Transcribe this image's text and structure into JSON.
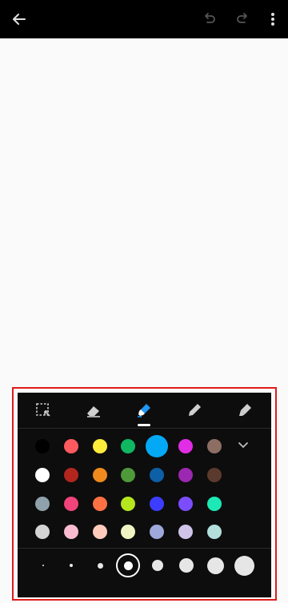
{
  "topbar": {
    "icons": [
      "back-arrow-icon",
      "undo-icon",
      "redo-icon",
      "more-vert-icon"
    ],
    "background": "#000000"
  },
  "tools": {
    "items": [
      "selection-icon",
      "eraser-icon",
      "highlighter-icon",
      "pen-icon",
      "marker-icon"
    ],
    "selected": "highlighter-icon",
    "selected_color": "#2196f3"
  },
  "palette": {
    "rows": [
      [
        "#000000",
        "#ff5a5f",
        "#ffeb3b",
        "#10b761",
        "#03a9f4",
        "#e12de6",
        "#8d6e63"
      ],
      [
        "#ffffff",
        "#b3261e",
        "#f08a1c",
        "#4e9a3a",
        "#0d5fa6",
        "#9c27b0",
        "#5b3a2e"
      ],
      [
        "#8fa1aa",
        "#f0447a",
        "#ff7043",
        "#b5e61d",
        "#3d3dff",
        "#7c4dff",
        "#1de9b6"
      ],
      [
        "#d4d4d4",
        "#f8bbd0",
        "#ffccbc",
        "#f0f4c3",
        "#9fa8da",
        "#d1c4e9",
        "#b2dfdb"
      ]
    ],
    "selected_color": "#03a9f4",
    "expand_icon": "chevron-down-icon"
  },
  "sizes": {
    "options": [
      1,
      2,
      3,
      4,
      5,
      6,
      7,
      8
    ],
    "selected": 4
  },
  "highlight_color": "#e01b1b"
}
